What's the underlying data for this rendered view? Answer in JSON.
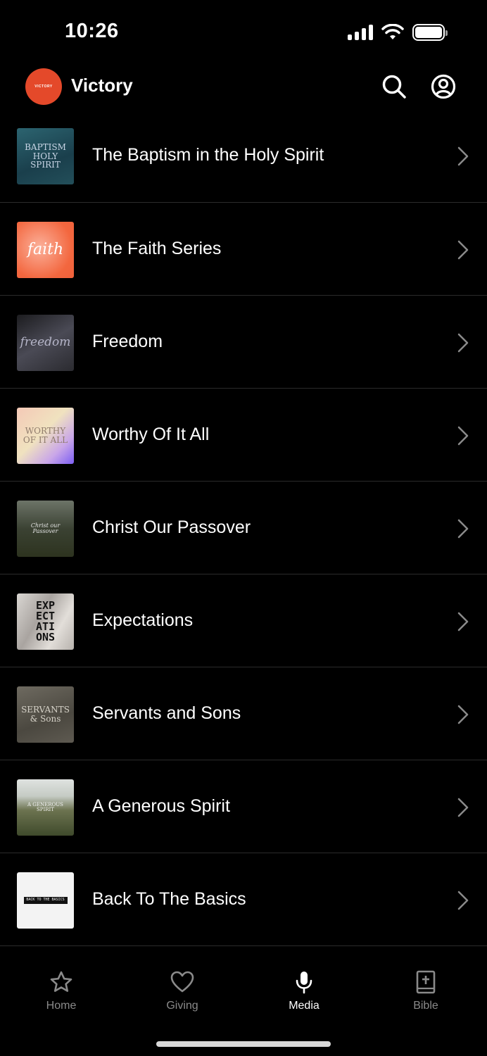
{
  "status": {
    "time": "10:26"
  },
  "header": {
    "title": "Victory",
    "logo_text": "VICTORY"
  },
  "series": [
    {
      "title": "The Baptism in the Holy Spirit",
      "thumb_text": "BAPTISM HOLY SPIRIT",
      "thumb_bg": "#1f4a56",
      "thumb_fg": "#c9d6e6"
    },
    {
      "title": "The Faith Series",
      "thumb_text": "faith",
      "thumb_bg": "#f2704a",
      "thumb_fg": "#ffffff"
    },
    {
      "title": "Freedom",
      "thumb_text": "freedom",
      "thumb_bg": "#3a3a3a",
      "thumb_fg": "#b5b5c8"
    },
    {
      "title": "Worthy Of It All",
      "thumb_text": "WORTHY OF IT ALL",
      "thumb_bg": "#e9c7b4",
      "thumb_fg": "#8f7b6c"
    },
    {
      "title": "Christ Our Passover",
      "thumb_text": "Christ our Passover",
      "thumb_bg": "#3c4236",
      "thumb_fg": "#e6e6e6"
    },
    {
      "title": "Expectations",
      "thumb_text": "EXP ECT ATI ONS",
      "thumb_bg": "#c9c4c0",
      "thumb_fg": "#111111"
    },
    {
      "title": "Servants and Sons",
      "thumb_text": "SERVANTS & Sons",
      "thumb_bg": "#5d5a52",
      "thumb_fg": "#d6d2c8"
    },
    {
      "title": "A Generous Spirit",
      "thumb_text": "A GENEROUS SPIRIT",
      "thumb_bg": "#5b6146",
      "thumb_fg": "#f2f2f2"
    },
    {
      "title": "Back To The Basics",
      "thumb_text": "BACK TO THE BASICS",
      "thumb_bg": "#f3f3f3",
      "thumb_fg": "#111111"
    }
  ],
  "tabs": [
    {
      "label": "Home",
      "icon": "star-icon",
      "active": false
    },
    {
      "label": "Giving",
      "icon": "heart-icon",
      "active": false
    },
    {
      "label": "Media",
      "icon": "microphone-icon",
      "active": true
    },
    {
      "label": "Bible",
      "icon": "bible-icon",
      "active": false
    }
  ]
}
